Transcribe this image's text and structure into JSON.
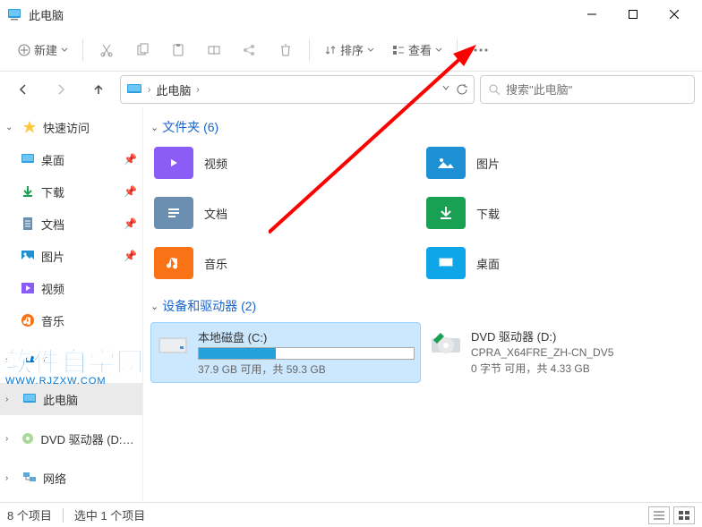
{
  "window": {
    "title": "此电脑"
  },
  "toolbar": {
    "new_label": "新建",
    "sort_label": "排序",
    "view_label": "查看"
  },
  "breadcrumb": {
    "text": "此电脑"
  },
  "search": {
    "placeholder": "搜索\"此电脑\""
  },
  "sidebar": {
    "quick_access": "快速访问",
    "desktop": "桌面",
    "downloads": "下载",
    "documents": "文档",
    "pictures": "图片",
    "videos": "视频",
    "music": "音乐",
    "onedrive_partial": "O.",
    "this_pc": "此电脑",
    "dvd": "DVD 驱动器 (D:) CP",
    "network": "网络"
  },
  "sections": {
    "folders_head": "文件夹 (6)",
    "drives_head": "设备和驱动器 (2)"
  },
  "folders": {
    "videos": "视频",
    "pictures": "图片",
    "documents": "文档",
    "downloads": "下载",
    "music": "音乐",
    "desktop": "桌面"
  },
  "drives": {
    "c_name": "本地磁盘 (C:)",
    "c_info": "37.9 GB 可用，共 59.3 GB",
    "c_fill_pct": 36,
    "d_name": "DVD 驱动器 (D:)",
    "d_sub": "CPRA_X64FRE_ZH-CN_DV5",
    "d_info": "0 字节 可用，共 4.33 GB"
  },
  "status": {
    "count": "8 个项目",
    "selected": "选中 1 个项目"
  },
  "watermark": {
    "main": "软件自学网",
    "sub": "WWW.RJZXW.COM"
  }
}
